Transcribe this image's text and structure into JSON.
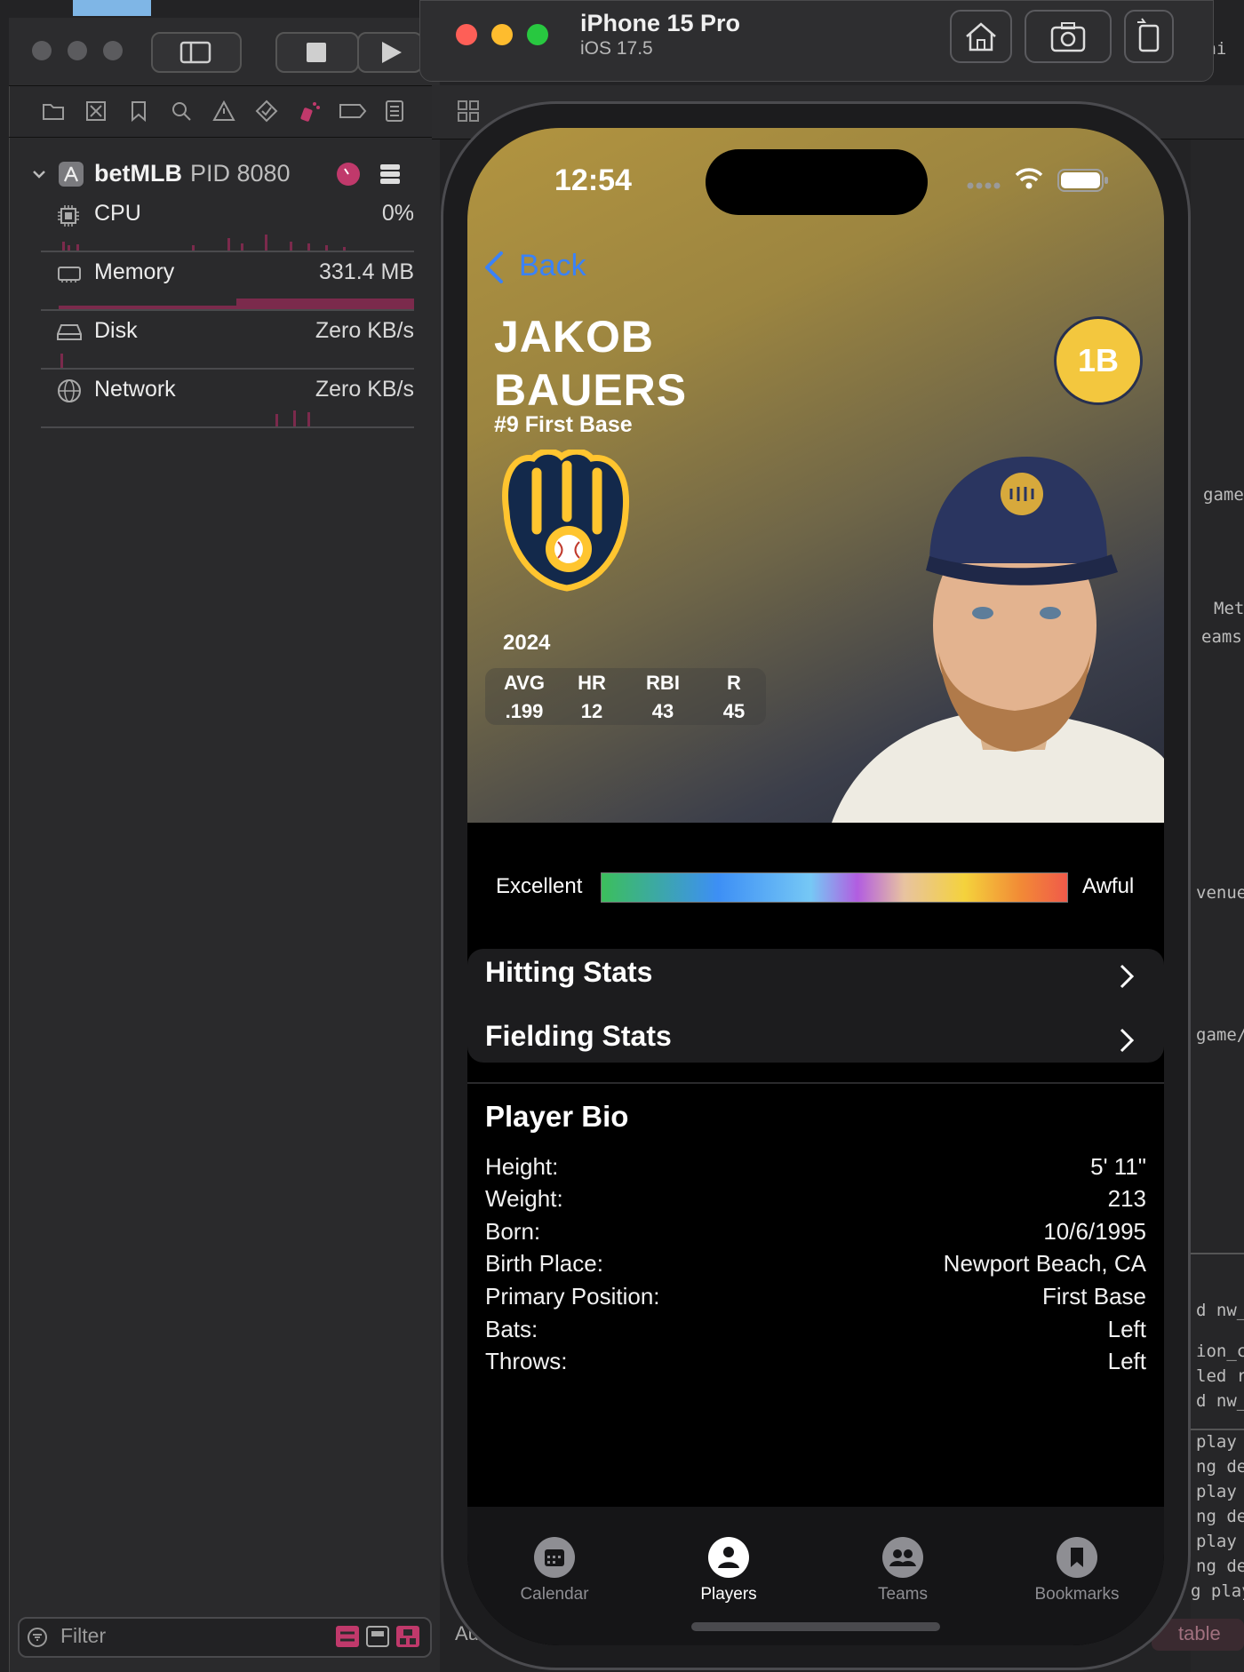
{
  "navigator": {
    "process": {
      "name": "betMLB",
      "pid_label": "PID 8080"
    },
    "gauges": [
      {
        "label": "CPU",
        "value": "0%"
      },
      {
        "label": "Memory",
        "value": "331.4 MB"
      },
      {
        "label": "Disk",
        "value": "Zero KB/s"
      },
      {
        "label": "Network",
        "value": "Zero KB/s"
      }
    ],
    "filter_placeholder": "Filter",
    "accent_color": "#c0396b"
  },
  "editor": {
    "fragments": [
      "nni",
      "game",
      "Met",
      "eams",
      "venue",
      "game/",
      "d nw_",
      "ion_c",
      "led r",
      "d nw_",
      "play",
      "ng de",
      "play",
      "ng de",
      "play",
      "ng de",
      "g play",
      "table",
      "Au"
    ]
  },
  "simulator": {
    "device": "iPhone 15 Pro",
    "os": "iOS 17.5"
  },
  "phone": {
    "status": {
      "time": "12:54"
    },
    "back_label": "Back",
    "player": {
      "first_name": "JAKOB",
      "last_name": "BAUERS",
      "subtitle": "#9 First Base",
      "position_badge": "1B",
      "badge_color": "#f3c73e"
    },
    "season": {
      "year": "2024",
      "headers": [
        "AVG",
        "HR",
        "RBI",
        "R"
      ],
      "values": [
        ".199",
        "12",
        "43",
        "45"
      ]
    },
    "rating_scale": {
      "left_label": "Excellent",
      "right_label": "Awful"
    },
    "stat_links": [
      {
        "label": "Hitting Stats"
      },
      {
        "label": "Fielding Stats"
      }
    ],
    "bio": {
      "title": "Player Bio",
      "rows": [
        {
          "key": "Height:",
          "value": "5' 11\""
        },
        {
          "key": "Weight:",
          "value": "213"
        },
        {
          "key": "Born:",
          "value": "10/6/1995"
        },
        {
          "key": "Birth Place:",
          "value": "Newport Beach, CA"
        },
        {
          "key": "Primary Position:",
          "value": "First Base"
        },
        {
          "key": "Bats:",
          "value": "Left"
        },
        {
          "key": "Throws:",
          "value": "Left"
        }
      ]
    },
    "tabs": [
      {
        "label": "Calendar",
        "icon": "calendar-icon",
        "selected": false
      },
      {
        "label": "Players",
        "icon": "person-icon",
        "selected": true
      },
      {
        "label": "Teams",
        "icon": "people-icon",
        "selected": false
      },
      {
        "label": "Bookmarks",
        "icon": "bookmark-icon",
        "selected": false
      }
    ]
  }
}
